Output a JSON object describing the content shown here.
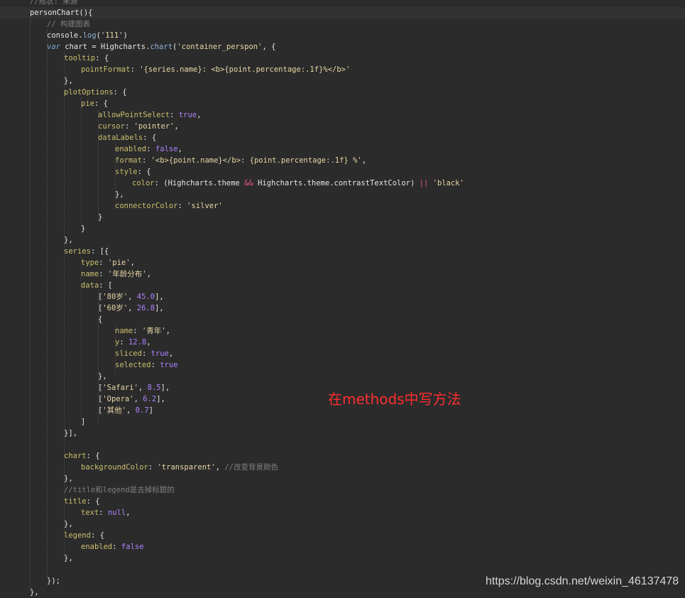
{
  "annotation": "在methods中写方法",
  "watermark": "https://blog.csdn.net/weixin_46137478",
  "lines": [
    {
      "indent": 1,
      "tokens": [
        {
          "t": "//规状: 来源",
          "c": "comment"
        }
      ]
    },
    {
      "indent": 1,
      "tokens": [
        {
          "t": "personChart(){",
          "c": "plain"
        }
      ]
    },
    {
      "indent": 2,
      "tokens": [
        {
          "t": "// 构建图表",
          "c": "comment"
        }
      ]
    },
    {
      "indent": 2,
      "tokens": [
        {
          "t": "console",
          "c": "plain"
        },
        {
          "t": ".",
          "c": "dot"
        },
        {
          "t": "log",
          "c": "method"
        },
        {
          "t": "(",
          "c": "plain"
        },
        {
          "t": "'111'",
          "c": "str"
        },
        {
          "t": ")",
          "c": "plain"
        }
      ]
    },
    {
      "indent": 2,
      "tokens": [
        {
          "t": "var",
          "c": "kw"
        },
        {
          "t": " chart = Highcharts",
          "c": "plain"
        },
        {
          "t": ".",
          "c": "dot"
        },
        {
          "t": "chart",
          "c": "method"
        },
        {
          "t": "(",
          "c": "plain"
        },
        {
          "t": "'container_perspon'",
          "c": "str"
        },
        {
          "t": ", {",
          "c": "plain"
        }
      ]
    },
    {
      "indent": 3,
      "tokens": [
        {
          "t": "tooltip",
          "c": "key"
        },
        {
          "t": ": {",
          "c": "plain"
        }
      ]
    },
    {
      "indent": 4,
      "tokens": [
        {
          "t": "pointFormat",
          "c": "key"
        },
        {
          "t": ": ",
          "c": "plain"
        },
        {
          "t": "'{series.name}: <b>{point.percentage:.1f}%</b>'",
          "c": "str"
        }
      ]
    },
    {
      "indent": 3,
      "tokens": [
        {
          "t": "},",
          "c": "plain"
        }
      ]
    },
    {
      "indent": 3,
      "tokens": [
        {
          "t": "plotOptions",
          "c": "key"
        },
        {
          "t": ": {",
          "c": "plain"
        }
      ]
    },
    {
      "indent": 4,
      "tokens": [
        {
          "t": "pie",
          "c": "key"
        },
        {
          "t": ": {",
          "c": "plain"
        }
      ]
    },
    {
      "indent": 5,
      "tokens": [
        {
          "t": "allowPointSelect",
          "c": "key"
        },
        {
          "t": ": ",
          "c": "plain"
        },
        {
          "t": "true",
          "c": "bool"
        },
        {
          "t": ",",
          "c": "plain"
        }
      ]
    },
    {
      "indent": 5,
      "tokens": [
        {
          "t": "cursor",
          "c": "key"
        },
        {
          "t": ": ",
          "c": "plain"
        },
        {
          "t": "'pointer'",
          "c": "str"
        },
        {
          "t": ",",
          "c": "plain"
        }
      ]
    },
    {
      "indent": 5,
      "tokens": [
        {
          "t": "dataLabels",
          "c": "key"
        },
        {
          "t": ": {",
          "c": "plain"
        }
      ]
    },
    {
      "indent": 6,
      "tokens": [
        {
          "t": "enabled",
          "c": "key"
        },
        {
          "t": ": ",
          "c": "plain"
        },
        {
          "t": "false",
          "c": "bool"
        },
        {
          "t": ",",
          "c": "plain"
        }
      ]
    },
    {
      "indent": 6,
      "tokens": [
        {
          "t": "format",
          "c": "key"
        },
        {
          "t": ": ",
          "c": "plain"
        },
        {
          "t": "'<b>{point.name}</b>: {point.percentage:.1f} %'",
          "c": "str"
        },
        {
          "t": ",",
          "c": "plain"
        }
      ]
    },
    {
      "indent": 6,
      "tokens": [
        {
          "t": "style",
          "c": "key"
        },
        {
          "t": ": {",
          "c": "plain"
        }
      ]
    },
    {
      "indent": 7,
      "tokens": [
        {
          "t": "color",
          "c": "key"
        },
        {
          "t": ": (Highcharts",
          "c": "plain"
        },
        {
          "t": ".",
          "c": "dot"
        },
        {
          "t": "theme ",
          "c": "plain"
        },
        {
          "t": "&&",
          "c": "op"
        },
        {
          "t": " Highcharts",
          "c": "plain"
        },
        {
          "t": ".",
          "c": "dot"
        },
        {
          "t": "theme",
          "c": "plain"
        },
        {
          "t": ".",
          "c": "dot"
        },
        {
          "t": "contrastTextColor) ",
          "c": "plain"
        },
        {
          "t": "||",
          "c": "op"
        },
        {
          "t": " ",
          "c": "plain"
        },
        {
          "t": "'black'",
          "c": "str"
        }
      ]
    },
    {
      "indent": 6,
      "tokens": [
        {
          "t": "},",
          "c": "plain"
        }
      ]
    },
    {
      "indent": 6,
      "tokens": [
        {
          "t": "connectorColor",
          "c": "key"
        },
        {
          "t": ": ",
          "c": "plain"
        },
        {
          "t": "'silver'",
          "c": "str"
        }
      ]
    },
    {
      "indent": 5,
      "tokens": [
        {
          "t": "}",
          "c": "plain"
        }
      ]
    },
    {
      "indent": 4,
      "tokens": [
        {
          "t": "}",
          "c": "plain"
        }
      ]
    },
    {
      "indent": 3,
      "tokens": [
        {
          "t": "},",
          "c": "plain"
        }
      ]
    },
    {
      "indent": 3,
      "tokens": [
        {
          "t": "series",
          "c": "key"
        },
        {
          "t": ": [{",
          "c": "plain"
        }
      ]
    },
    {
      "indent": 4,
      "tokens": [
        {
          "t": "type",
          "c": "key"
        },
        {
          "t": ": ",
          "c": "plain"
        },
        {
          "t": "'pie'",
          "c": "str"
        },
        {
          "t": ",",
          "c": "plain"
        }
      ]
    },
    {
      "indent": 4,
      "tokens": [
        {
          "t": "name",
          "c": "key"
        },
        {
          "t": ": ",
          "c": "plain"
        },
        {
          "t": "'年龄分布'",
          "c": "str"
        },
        {
          "t": ",",
          "c": "plain"
        }
      ]
    },
    {
      "indent": 4,
      "tokens": [
        {
          "t": "data",
          "c": "key"
        },
        {
          "t": ": [",
          "c": "plain"
        }
      ]
    },
    {
      "indent": 5,
      "tokens": [
        {
          "t": "[",
          "c": "plain"
        },
        {
          "t": "'80岁'",
          "c": "str"
        },
        {
          "t": ", ",
          "c": "plain"
        },
        {
          "t": "45.0",
          "c": "num"
        },
        {
          "t": "],",
          "c": "plain"
        }
      ]
    },
    {
      "indent": 5,
      "tokens": [
        {
          "t": "[",
          "c": "plain"
        },
        {
          "t": "'60岁'",
          "c": "str"
        },
        {
          "t": ", ",
          "c": "plain"
        },
        {
          "t": "26.8",
          "c": "num"
        },
        {
          "t": "],",
          "c": "plain"
        }
      ]
    },
    {
      "indent": 5,
      "tokens": [
        {
          "t": "{",
          "c": "plain"
        }
      ]
    },
    {
      "indent": 6,
      "tokens": [
        {
          "t": "name",
          "c": "key"
        },
        {
          "t": ": ",
          "c": "plain"
        },
        {
          "t": "'青年'",
          "c": "str"
        },
        {
          "t": ",",
          "c": "plain"
        }
      ]
    },
    {
      "indent": 6,
      "tokens": [
        {
          "t": "y",
          "c": "key"
        },
        {
          "t": ": ",
          "c": "plain"
        },
        {
          "t": "12.8",
          "c": "num"
        },
        {
          "t": ",",
          "c": "plain"
        }
      ]
    },
    {
      "indent": 6,
      "tokens": [
        {
          "t": "sliced",
          "c": "key"
        },
        {
          "t": ": ",
          "c": "plain"
        },
        {
          "t": "true",
          "c": "bool"
        },
        {
          "t": ",",
          "c": "plain"
        }
      ]
    },
    {
      "indent": 6,
      "tokens": [
        {
          "t": "selected",
          "c": "key"
        },
        {
          "t": ": ",
          "c": "plain"
        },
        {
          "t": "true",
          "c": "bool"
        }
      ]
    },
    {
      "indent": 5,
      "tokens": [
        {
          "t": "},",
          "c": "plain"
        }
      ]
    },
    {
      "indent": 5,
      "tokens": [
        {
          "t": "[",
          "c": "plain"
        },
        {
          "t": "'Safari'",
          "c": "str"
        },
        {
          "t": ", ",
          "c": "plain"
        },
        {
          "t": "8.5",
          "c": "num"
        },
        {
          "t": "],",
          "c": "plain"
        }
      ]
    },
    {
      "indent": 5,
      "tokens": [
        {
          "t": "[",
          "c": "plain"
        },
        {
          "t": "'Opera'",
          "c": "str"
        },
        {
          "t": ", ",
          "c": "plain"
        },
        {
          "t": "6.2",
          "c": "num"
        },
        {
          "t": "],",
          "c": "plain"
        }
      ]
    },
    {
      "indent": 5,
      "tokens": [
        {
          "t": "[",
          "c": "plain"
        },
        {
          "t": "'其他'",
          "c": "str"
        },
        {
          "t": ", ",
          "c": "plain"
        },
        {
          "t": "0.7",
          "c": "num"
        },
        {
          "t": "]",
          "c": "plain"
        }
      ]
    },
    {
      "indent": 4,
      "tokens": [
        {
          "t": "]",
          "c": "plain"
        }
      ]
    },
    {
      "indent": 3,
      "tokens": [
        {
          "t": "}],",
          "c": "plain"
        }
      ]
    },
    {
      "indent": 0,
      "tokens": []
    },
    {
      "indent": 3,
      "tokens": [
        {
          "t": "chart",
          "c": "key"
        },
        {
          "t": ": {",
          "c": "plain"
        }
      ]
    },
    {
      "indent": 4,
      "tokens": [
        {
          "t": "backgroundColor",
          "c": "key"
        },
        {
          "t": ": ",
          "c": "plain"
        },
        {
          "t": "'transparent'",
          "c": "str"
        },
        {
          "t": ", ",
          "c": "plain"
        },
        {
          "t": "//改变背景颜色",
          "c": "comment"
        }
      ]
    },
    {
      "indent": 3,
      "tokens": [
        {
          "t": "},",
          "c": "plain"
        }
      ]
    },
    {
      "indent": 3,
      "tokens": [
        {
          "t": "//title和legend是去掉标题的",
          "c": "comment"
        }
      ]
    },
    {
      "indent": 3,
      "tokens": [
        {
          "t": "title",
          "c": "key"
        },
        {
          "t": ": {",
          "c": "plain"
        }
      ]
    },
    {
      "indent": 4,
      "tokens": [
        {
          "t": "text",
          "c": "key"
        },
        {
          "t": ": ",
          "c": "plain"
        },
        {
          "t": "null",
          "c": "bool"
        },
        {
          "t": ",",
          "c": "plain"
        }
      ]
    },
    {
      "indent": 3,
      "tokens": [
        {
          "t": "},",
          "c": "plain"
        }
      ]
    },
    {
      "indent": 3,
      "tokens": [
        {
          "t": "legend",
          "c": "key"
        },
        {
          "t": ": {",
          "c": "plain"
        }
      ]
    },
    {
      "indent": 4,
      "tokens": [
        {
          "t": "enabled",
          "c": "key"
        },
        {
          "t": ": ",
          "c": "plain"
        },
        {
          "t": "false",
          "c": "bool"
        }
      ]
    },
    {
      "indent": 3,
      "tokens": [
        {
          "t": "},",
          "c": "plain"
        }
      ]
    },
    {
      "indent": 0,
      "tokens": []
    },
    {
      "indent": 2,
      "tokens": [
        {
          "t": "});",
          "c": "plain"
        }
      ]
    },
    {
      "indent": 1,
      "tokens": [
        {
          "t": "},",
          "c": "plain"
        }
      ]
    }
  ]
}
